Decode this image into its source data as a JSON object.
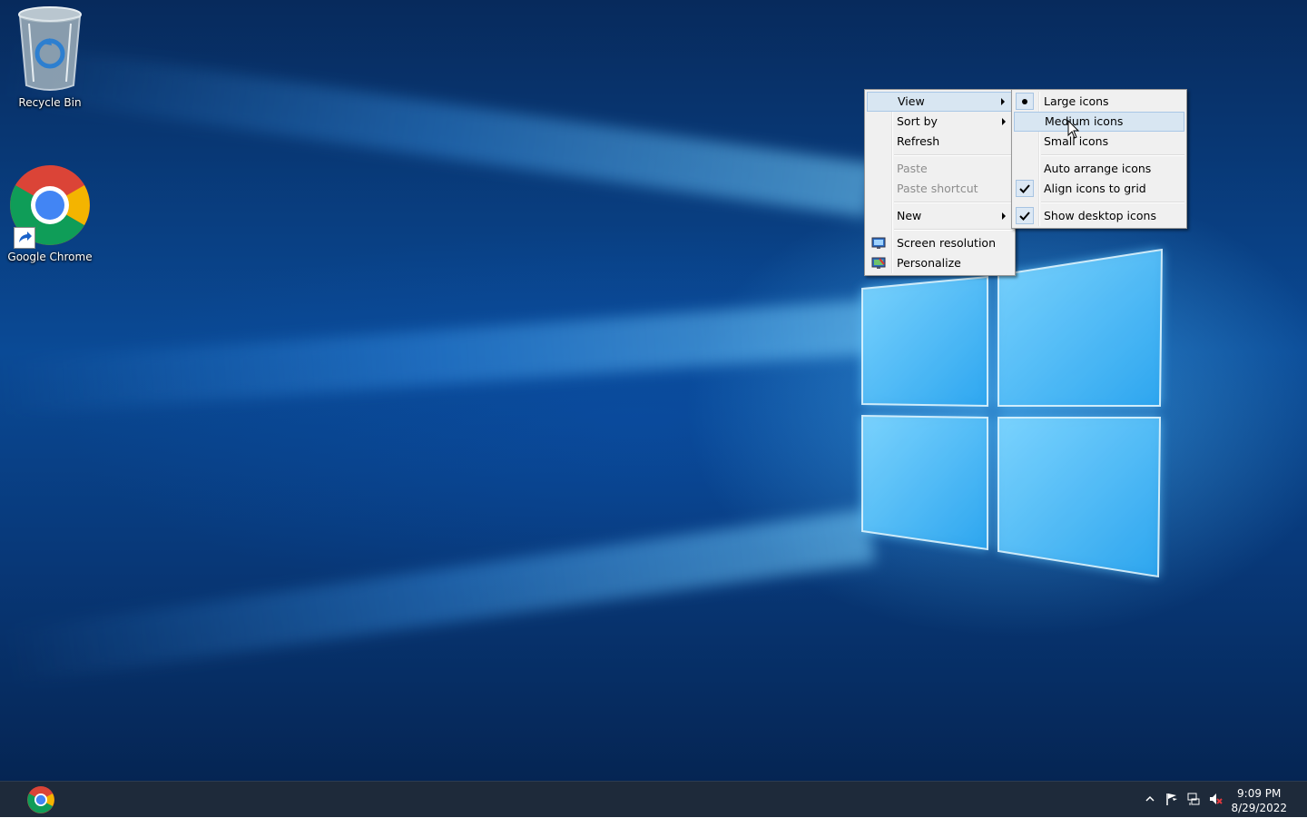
{
  "desktop": {
    "icons": [
      {
        "label": "Recycle Bin",
        "icon": "recycle-bin-icon"
      },
      {
        "label": "Google Chrome",
        "icon": "chrome-icon"
      }
    ]
  },
  "context_menu": {
    "items": [
      {
        "label": "View",
        "has_submenu": true,
        "highlighted": true
      },
      {
        "label": "Sort by",
        "has_submenu": true
      },
      {
        "label": "Refresh"
      },
      {
        "label": "Paste",
        "disabled": true
      },
      {
        "label": "Paste shortcut",
        "disabled": true
      },
      {
        "label": "New",
        "has_submenu": true
      },
      {
        "label": "Screen resolution",
        "icon": "screen-resolution-icon"
      },
      {
        "label": "Personalize",
        "icon": "personalize-icon"
      }
    ]
  },
  "view_submenu": {
    "items": [
      {
        "label": "Large icons",
        "state": "selected-radio"
      },
      {
        "label": "Medium icons",
        "highlighted": true
      },
      {
        "label": "Small icons"
      },
      {
        "label": "Auto arrange icons"
      },
      {
        "label": "Align icons to grid",
        "state": "checked"
      },
      {
        "label": "Show desktop icons",
        "state": "checked"
      }
    ]
  },
  "taskbar": {
    "pinned": [
      {
        "icon": "chrome-icon"
      }
    ],
    "tray": [
      "show-hidden-icons-arrow",
      "action-center-flag-icon",
      "network-icon",
      "volume-muted-icon"
    ],
    "clock": {
      "time": "9:09 PM",
      "date": "8/29/2022"
    }
  },
  "colors": {
    "menu_bg": "#f0f0f0",
    "menu_highlight": "#d8e6f2",
    "taskbar_bg": "#1e2a3a"
  }
}
